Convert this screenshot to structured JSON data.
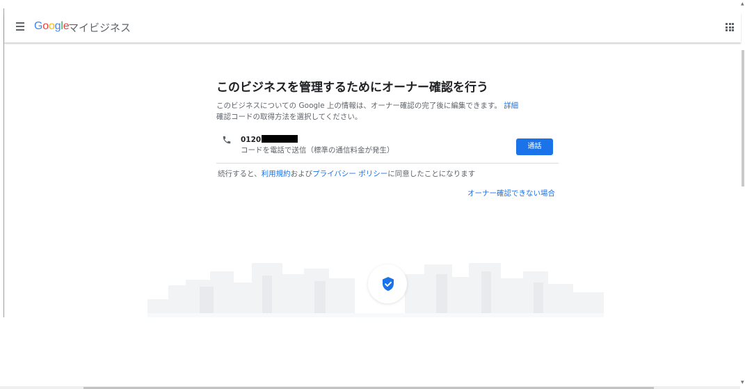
{
  "header": {
    "logo": {
      "letters": [
        {
          "char": "G",
          "color": "#4285f4"
        },
        {
          "char": "o",
          "color": "#ea4335"
        },
        {
          "char": "o",
          "color": "#fbbc05"
        },
        {
          "char": "g",
          "color": "#4285f4"
        },
        {
          "char": "l",
          "color": "#34a853"
        },
        {
          "char": "e",
          "color": "#ea4335"
        }
      ]
    },
    "product_name": "マイビジネス",
    "menu_icon": "hamburger-menu-icon",
    "apps_icon": "apps-grid-icon"
  },
  "main": {
    "title": "このビジネスを管理するためにオーナー確認を行う",
    "description_line1": "このビジネスについての Google 上の情報は、オーナー確認の完了後に編集できます。",
    "details_link": "詳細",
    "description_line2": "確認コードの取得方法を選択してください。",
    "option": {
      "icon": "phone-icon",
      "phone_prefix": "0120",
      "phone_redacted": true,
      "subtitle": "コードを電話で送信（標準の通信料金が発生）",
      "button_label": "通話"
    },
    "terms": {
      "prefix": "続行すると、",
      "terms_link": "利用規約",
      "middle": "および",
      "privacy_link": "プライバシー ポリシー",
      "suffix": "に同意したことになります"
    },
    "cannot_verify_link": "オーナー確認できない場合"
  },
  "illustration": {
    "badge_icon": "verified-shield-icon"
  },
  "colors": {
    "accent": "#1a73e8",
    "text_primary": "#202124",
    "text_secondary": "#5f6368"
  }
}
